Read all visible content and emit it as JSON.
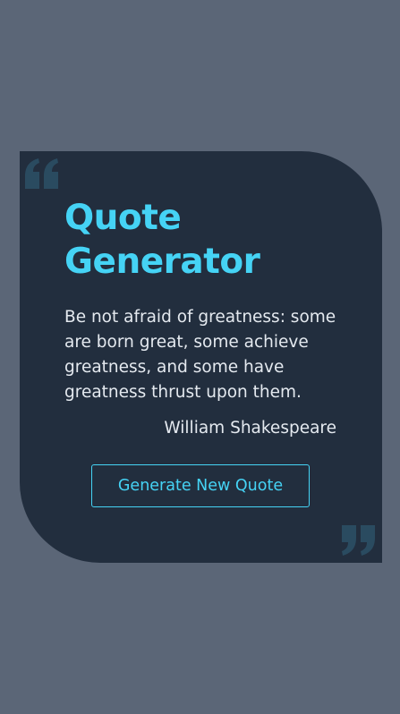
{
  "app": {
    "title": "Quote Generator"
  },
  "quote": {
    "text": "Be not afraid of greatness: some are born great, some achieve greatness, and some have greatness thrust upon them.",
    "author": "William Shakespeare"
  },
  "actions": {
    "generate_label": "Generate New Quote"
  },
  "icons": {
    "open": "quote-open-icon",
    "close": "quote-close-icon"
  },
  "colors": {
    "background": "#5b6677",
    "card": "#222e3e",
    "accent": "#45d3f5",
    "text": "#e4e9ef",
    "quote_mark": "#2a4b60"
  }
}
